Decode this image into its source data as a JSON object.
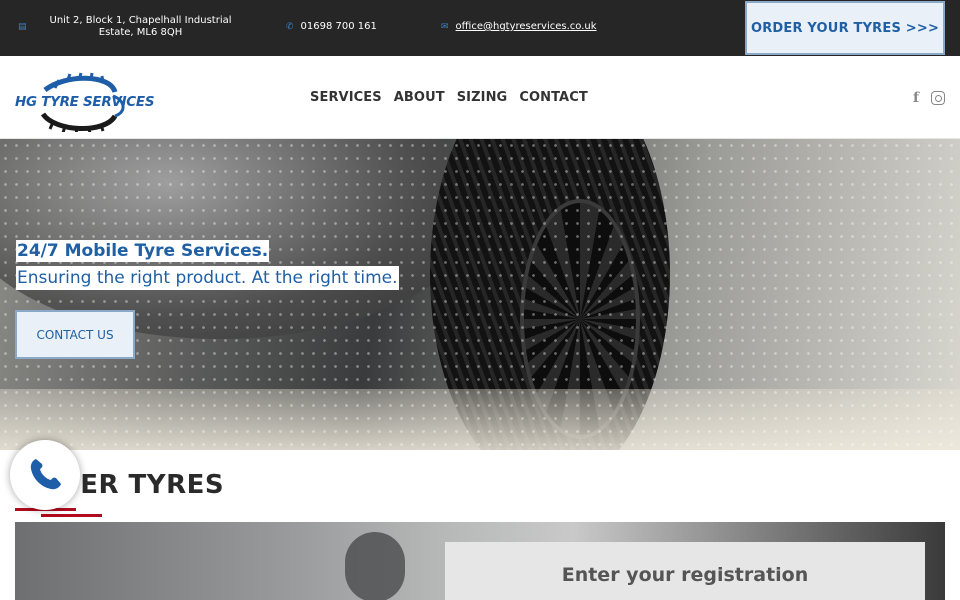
{
  "topbar": {
    "address": "Unit 2, Block 1, Chapelhall Industrial Estate, ML6 8QH",
    "address_icon": "map-icon",
    "phone": "01698 700 161",
    "phone_icon": "phone-icon",
    "email": "office@hgtyreservices.co.uk",
    "email_icon": "envelope-icon",
    "order_button": "ORDER YOUR TYRES >>>"
  },
  "header": {
    "logo_text": "HG TYRE SERVICES",
    "nav": [
      "SERVICES",
      "ABOUT",
      "SIZING",
      "CONTACT"
    ],
    "social": [
      "facebook-icon",
      "instagram-icon"
    ]
  },
  "hero": {
    "line1": "24/7 Mobile Tyre Services.",
    "line2": "Ensuring the right product. At the right time.",
    "button": "CONTACT US"
  },
  "order": {
    "title": "ORDER TYRES",
    "placeholder": "Enter your registration"
  },
  "colors": {
    "brand_blue": "#1f5fa3",
    "accent_red": "#b00b1e",
    "topbar_bg": "#262626"
  }
}
